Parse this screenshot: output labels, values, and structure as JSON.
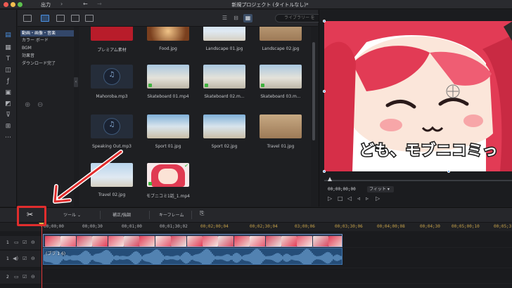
{
  "titlebar": {
    "menu_output": "出力",
    "window_title": "新規プロジェクト (タイトルなし)*"
  },
  "library": {
    "search_placeholder": "ライブラリー を",
    "categories": [
      {
        "label": "動画・画像・音楽",
        "active": true
      },
      {
        "label": "カラー ボード",
        "active": false
      },
      {
        "label": "BGM",
        "active": false
      },
      {
        "label": "効果音",
        "active": false
      },
      {
        "label": "ダウンロード完了",
        "active": false
      }
    ],
    "media": [
      {
        "caption": "プレミアム素材",
        "kind": "premium"
      },
      {
        "caption": "Food.jpg",
        "kind": "food"
      },
      {
        "caption": "Landscape 01.jpg",
        "kind": "sky"
      },
      {
        "caption": "Landscape 02.jpg",
        "kind": "warm"
      },
      {
        "caption": "Mahoroba.mp3",
        "kind": "music"
      },
      {
        "caption": "Skateboard 01.mp4",
        "kind": "street"
      },
      {
        "caption": "Skateboard 02.m...",
        "kind": "street"
      },
      {
        "caption": "Skateboard 03.m...",
        "kind": "street"
      },
      {
        "caption": "Speaking Out.mp3",
        "kind": "music"
      },
      {
        "caption": "Sport 01.jpg",
        "kind": "beach"
      },
      {
        "caption": "Sport 02.jpg",
        "kind": "beach"
      },
      {
        "caption": "Travel 01.jpg",
        "kind": "warm"
      },
      {
        "caption": "Travel 02.jpg",
        "kind": "sky"
      },
      {
        "caption": "モブニコミ1話_1.mp4",
        "kind": "anime"
      }
    ]
  },
  "preview": {
    "subtitle_text": "ども、モブニコミっ",
    "timecode": "00;00;00;00",
    "fit_label": "フィット"
  },
  "timeline_toolbar": {
    "tool_label": "ツール",
    "correct_label": "補正/強調",
    "keyframe_label": "キーフレーム"
  },
  "ruler": {
    "labels": [
      "00;00;00",
      "00;00;30",
      "00;01;00",
      "00;01;30;02",
      "00;02;00;04",
      "00;02;30;04",
      "03;00;06",
      "00;03;30;06",
      "00;04;00;08",
      "00;04;30",
      "00;05;00;10",
      "00;05;3"
    ]
  },
  "tracks": [
    {
      "number": "1",
      "kind": "video"
    },
    {
      "number": "1",
      "kind": "audio"
    },
    {
      "number": "2",
      "kind": "video"
    }
  ],
  "audio_clip_label": "(ブフ 1 6)",
  "colors": {
    "accent": "#4a90e2",
    "highlight": "#e12d2d",
    "clip_video": "#2d3a53",
    "clip_audio": "#254d78"
  }
}
